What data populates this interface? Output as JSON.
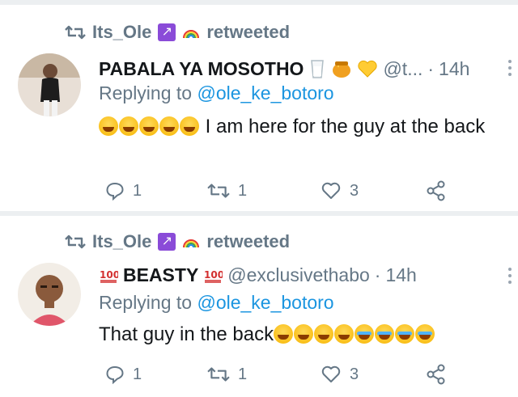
{
  "tweets": [
    {
      "retweet_label": "Its_Ole",
      "retweet_suffix": "retweeted",
      "name": "PABALA YA MOSOTHO",
      "handle": "@t...",
      "time": "14h",
      "reply_prefix": "Replying to",
      "reply_to": "@ole_ke_botoro",
      "text": "I am here for the guy at the back",
      "emoji_count_lead": 5,
      "reply_count": "1",
      "retweet_count": "1",
      "like_count": "3"
    },
    {
      "retweet_label": "Its_Ole",
      "retweet_suffix": "retweeted",
      "name": "BEASTY",
      "handle": "@exclusivethabo",
      "time": "14h",
      "reply_prefix": "Replying to",
      "reply_to": "@ole_ke_botoro",
      "text": "That guy in the back",
      "emoji_count_trail": 8,
      "reply_count": "1",
      "retweet_count": "1",
      "like_count": "3"
    }
  ],
  "separator": "·",
  "colors": {
    "muted": "#657786",
    "link": "#1b95e0",
    "text": "#14171a"
  },
  "icons": [
    "retweet-icon",
    "sagittarius-icon",
    "rainbow-icon",
    "reply-icon",
    "like-icon",
    "share-icon",
    "more-icon",
    "hundred-icon",
    "milk-icon",
    "honey-pot-icon",
    "yellow-heart-icon"
  ]
}
